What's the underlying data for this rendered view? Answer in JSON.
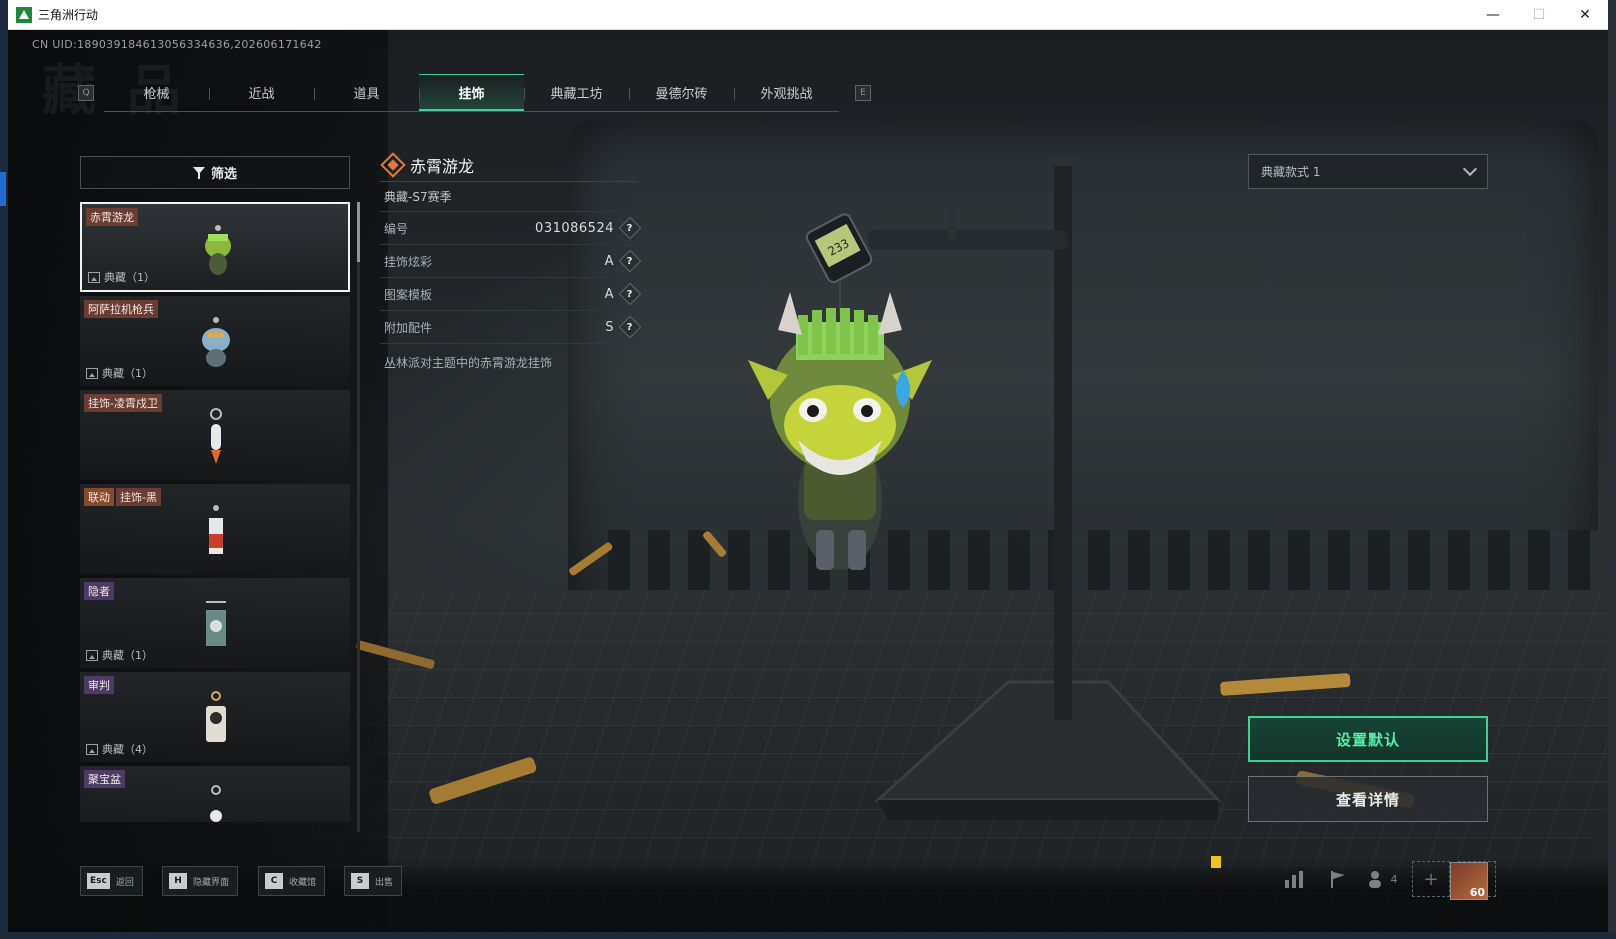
{
  "window": {
    "title": "三角洲行动",
    "min": "—",
    "max": "☐",
    "close": "✕"
  },
  "uid_text": "CN UID:18903918461305633463​6,202606171642",
  "watermark": "藏 品",
  "tabs": {
    "prev_key": "Q",
    "next_key": "E",
    "items": [
      {
        "label": "枪械",
        "active": false
      },
      {
        "label": "近战",
        "active": false
      },
      {
        "label": "道具",
        "active": false
      },
      {
        "label": "挂饰",
        "active": true
      },
      {
        "label": "典藏工坊",
        "active": false
      },
      {
        "label": "曼德尔砖",
        "active": false
      },
      {
        "label": "外观挑战",
        "active": false
      }
    ]
  },
  "filter": {
    "label": "筛选"
  },
  "list": [
    {
      "tags": [
        "赤霄游龙"
      ],
      "collect": "典藏（1）",
      "selected": true
    },
    {
      "tags": [
        "阿萨拉机枪兵"
      ],
      "collect": "典藏（1）",
      "selected": false
    },
    {
      "tags": [
        "挂饰-凌霄戍卫"
      ],
      "collect": "",
      "selected": false
    },
    {
      "tags": [
        "联动",
        "挂饰-黑"
      ],
      "collect": "",
      "selected": false
    },
    {
      "tags": [
        "隐者"
      ],
      "collect": "典藏（1）",
      "selected": false
    },
    {
      "tags": [
        "审判"
      ],
      "collect": "典藏（4）",
      "selected": false
    },
    {
      "tags": [
        "聚宝盆"
      ],
      "collect": "",
      "selected": false
    }
  ],
  "detail": {
    "name": "赤霄游龙",
    "season": "典藏-S7赛季",
    "rows": [
      {
        "label": "编号",
        "value": "031086524"
      },
      {
        "label": "挂饰炫彩",
        "value": "A"
      },
      {
        "label": "图案模板",
        "value": "A"
      },
      {
        "label": "附加配件",
        "value": "S"
      }
    ],
    "help": "?",
    "description": "丛林派对主题中的赤霄游龙挂饰"
  },
  "variant": {
    "selected": "典藏款式 1"
  },
  "scale_reading": "233",
  "buttons": {
    "set_default": "设置默认",
    "view_details": "查看详情"
  },
  "hotkeys": [
    {
      "key": "Esc",
      "label": "返回"
    },
    {
      "key": "H",
      "label": "隐藏界面"
    },
    {
      "key": "C",
      "label": "收藏馆"
    },
    {
      "key": "S",
      "label": "出售"
    }
  ],
  "tray": {
    "friends_count": "4",
    "plus": "+",
    "level": "60"
  },
  "colors": {
    "accent": "#3fcf92",
    "rarity": "#e07a3a",
    "tag_red": "#6b3c32",
    "tag_purple": "#4d3b66"
  }
}
